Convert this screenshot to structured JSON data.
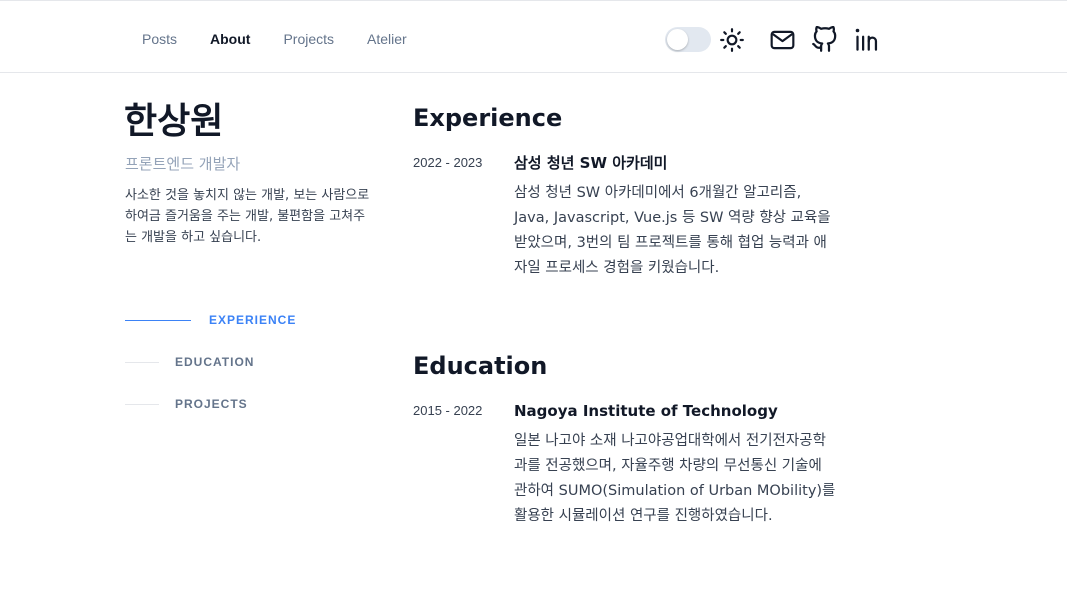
{
  "nav": {
    "items": [
      {
        "label": "Posts",
        "active": false
      },
      {
        "label": "About",
        "active": true
      },
      {
        "label": "Projects",
        "active": false
      },
      {
        "label": "Atelier",
        "active": false
      }
    ]
  },
  "header_icons": {
    "theme_toggle": "theme-toggle",
    "sun": "sun-icon",
    "mail": "mail-icon",
    "github": "github-icon",
    "linkedin": "linkedin-icon"
  },
  "profile": {
    "name": "한상원",
    "role": "프론트엔드 개발자",
    "bio": "사소한 것을 놓치지 않는 개발, 보는 사람으로 하여금 즐거움을 주는 개발, 불편함을 고쳐주는 개발을 하고 싶습니다."
  },
  "side_nav": [
    {
      "label": "EXPERIENCE",
      "active": true
    },
    {
      "label": "EDUCATION",
      "active": false
    },
    {
      "label": "PROJECTS",
      "active": false
    }
  ],
  "experience": {
    "title": "Experience",
    "entries": [
      {
        "period": "2022 - 2023",
        "title": "삼성 청년 SW 아카데미",
        "description": "삼성 청년 SW 아카데미에서 6개월간 알고리즘, Java, Javascript, Vue.js 등 SW 역량 향상 교육을 받았으며, 3번의 팀 프로젝트를 통해 협업 능력과 애자일 프로세스 경험을 키웠습니다."
      }
    ]
  },
  "education": {
    "title": "Education",
    "entries": [
      {
        "period": "2015 - 2022",
        "title": "Nagoya Institute of Technology",
        "description": "일본 나고야 소재 나고야공업대학에서 전기전자공학과를 전공했으며, 자율주행 차량의 무선통신 기술에 관하여 SUMO(Simulation of Urban MObility)를 활용한 시뮬레이션 연구를 진행하였습니다."
      }
    ]
  },
  "colors": {
    "accent": "#3b82f6",
    "muted": "#64748b",
    "text": "#111827"
  }
}
